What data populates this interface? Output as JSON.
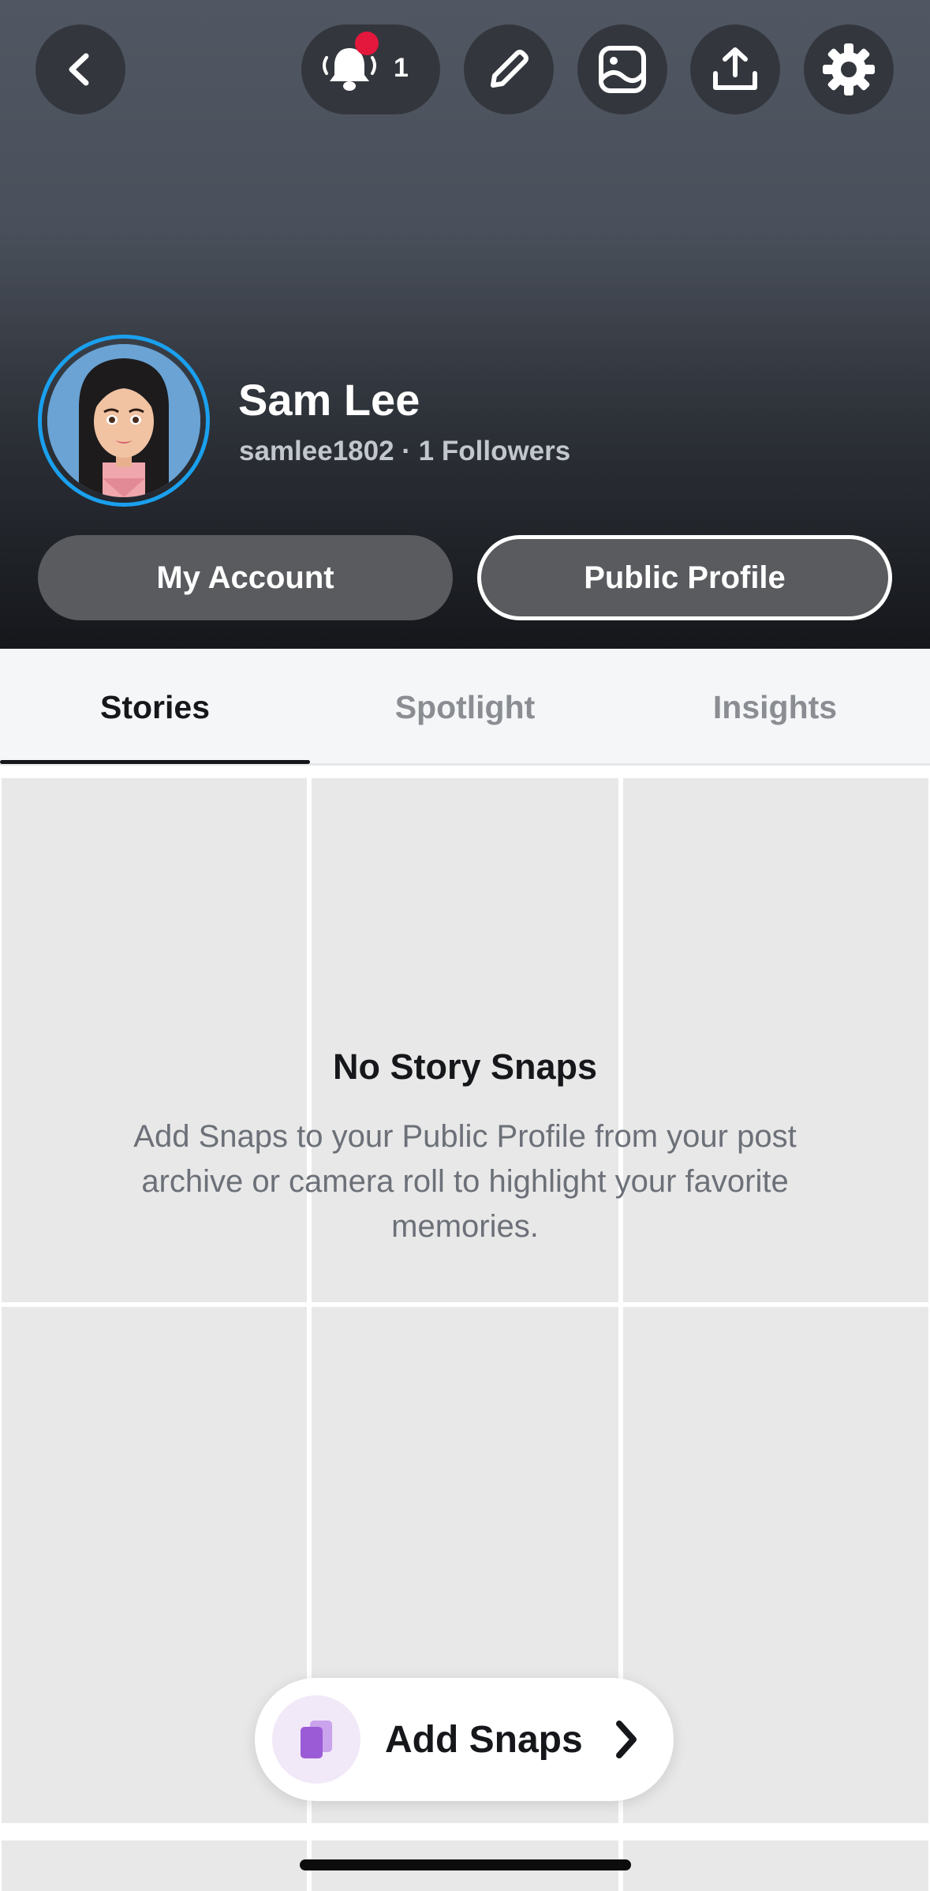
{
  "header": {
    "notification_count": "1",
    "icons": {
      "back": "chevron-left-icon",
      "notifications": "bell-icon",
      "edit": "pencil-icon",
      "gallery": "image-icon",
      "share": "upload-icon",
      "settings": "gear-icon"
    }
  },
  "profile": {
    "name": "Sam Lee",
    "subtitle": "samlee1802 · 1 Followers",
    "ring_color": "#1aa0ee"
  },
  "buttons": {
    "my_account": "My Account",
    "public_profile": "Public Profile"
  },
  "tabs": [
    {
      "label": "Stories",
      "active": true
    },
    {
      "label": "Spotlight",
      "active": false
    },
    {
      "label": "Insights",
      "active": false
    }
  ],
  "empty_state": {
    "title": "No Story Snaps",
    "text": "Add Snaps to your Public Profile from your post archive or camera roll to highlight your favorite memories."
  },
  "add_snaps": {
    "label": "Add Snaps",
    "accent": "#9b5bd6"
  }
}
